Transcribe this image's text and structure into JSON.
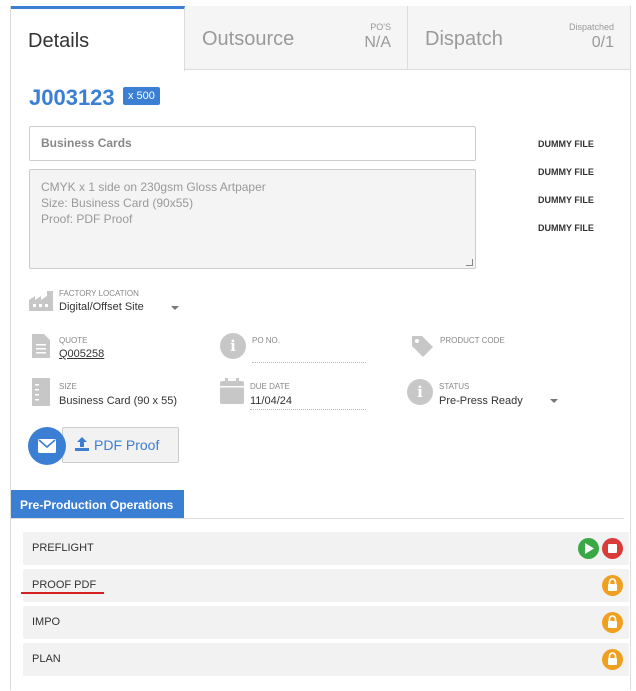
{
  "tabs": [
    {
      "label": "Details"
    },
    {
      "label": "Outsource",
      "meta_title": "PO'S",
      "meta_value": "N/A"
    },
    {
      "label": "Dispatch",
      "meta_title": "Dispatched",
      "meta_value": "0/1"
    }
  ],
  "job": {
    "number": "J003123",
    "quantity": "x 500"
  },
  "title_field": {
    "value": "Business Cards"
  },
  "description": {
    "lines": [
      "CMYK x 1 side on 230gsm Gloss Artpaper",
      "Size: Business Card (90x55)",
      "Proof: PDF Proof"
    ]
  },
  "files": [
    "DUMMY FILE",
    "DUMMY FILE",
    "DUMMY FILE",
    "DUMMY FILE"
  ],
  "factory_location": {
    "label": "FACTORY LOCATION",
    "value": "Digital/Offset Site"
  },
  "quote": {
    "label": "QUOTE",
    "value": "Q005258"
  },
  "po_no": {
    "label": "PO NO.",
    "value": ""
  },
  "product_code": {
    "label": "PRODUCT CODE",
    "value": ""
  },
  "size": {
    "label": "SIZE",
    "value": "Business Card (90 x 55)"
  },
  "due_date": {
    "label": "DUE DATE",
    "value": "11/04/24"
  },
  "status": {
    "label": "STATUS",
    "value": "Pre-Press Ready"
  },
  "pdf_proof_button": {
    "label": "PDF Proof"
  },
  "section": {
    "title": "Pre-Production Operations"
  },
  "operations": [
    {
      "label": "PREFLIGHT",
      "state": "active"
    },
    {
      "label": "PROOF PDF",
      "state": "locked"
    },
    {
      "label": "IMPO",
      "state": "locked"
    },
    {
      "label": "PLAN",
      "state": "locked"
    }
  ],
  "colors": {
    "accent": "#3a7fd4",
    "play": "#3aa845",
    "stop": "#d93a3a",
    "lock": "#f0a020",
    "annotation": "#d42020"
  },
  "icons": {
    "factory": "factory-icon",
    "document": "document-icon",
    "info": "info-icon",
    "tag": "tag-icon",
    "calendar": "calendar-icon",
    "mail": "mail-icon",
    "upload": "upload-icon",
    "play": "play-icon",
    "stop": "stop-icon",
    "lock": "lock-icon"
  }
}
